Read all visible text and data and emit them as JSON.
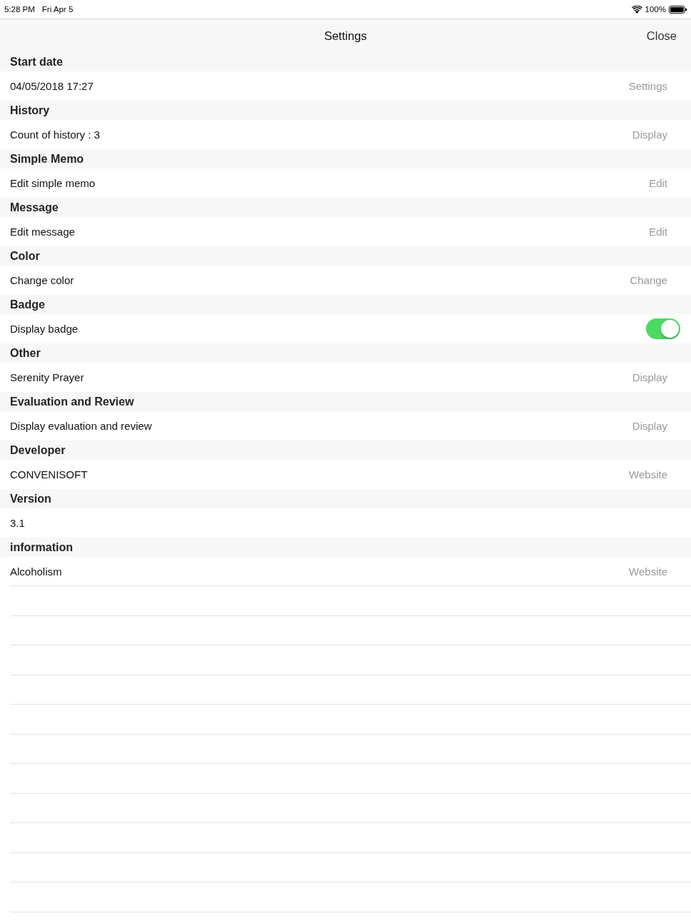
{
  "status_bar": {
    "time": "5:28 PM",
    "date": "Fri Apr 5",
    "battery": "100%"
  },
  "nav_bar": {
    "title": "Settings",
    "close": "Close"
  },
  "sections": [
    {
      "header": "Start date",
      "rows": [
        {
          "kind": "detail",
          "label": "04/05/2018 17:27",
          "detail": "Settings"
        }
      ]
    },
    {
      "header": "History",
      "rows": [
        {
          "kind": "detail",
          "label": "Count of history : 3",
          "detail": "Display"
        }
      ]
    },
    {
      "header": "Simple Memo",
      "rows": [
        {
          "kind": "detail",
          "label": "Edit simple memo",
          "detail": "Edit"
        }
      ]
    },
    {
      "header": "Message",
      "rows": [
        {
          "kind": "detail",
          "label": "Edit message",
          "detail": "Edit"
        }
      ]
    },
    {
      "header": "Color",
      "rows": [
        {
          "kind": "detail",
          "label": "Change color",
          "detail": "Change"
        }
      ]
    },
    {
      "header": "Badge",
      "rows": [
        {
          "kind": "toggle",
          "label": "Display badge",
          "on": true
        }
      ]
    },
    {
      "header": "Other",
      "rows": [
        {
          "kind": "detail",
          "label": "Serenity Prayer",
          "detail": "Display"
        }
      ]
    },
    {
      "header": "Evaluation and Review",
      "rows": [
        {
          "kind": "detail",
          "label": "Display evaluation and review",
          "detail": "Display"
        }
      ]
    },
    {
      "header": "Developer",
      "rows": [
        {
          "kind": "detail",
          "label": "CONVENISOFT",
          "detail": "Website"
        }
      ]
    },
    {
      "header": "Version",
      "rows": [
        {
          "kind": "plain",
          "label": "3.1"
        }
      ]
    },
    {
      "header": "information",
      "rows": [
        {
          "kind": "detail",
          "label": "Alcoholism",
          "detail": "Website"
        }
      ]
    }
  ]
}
